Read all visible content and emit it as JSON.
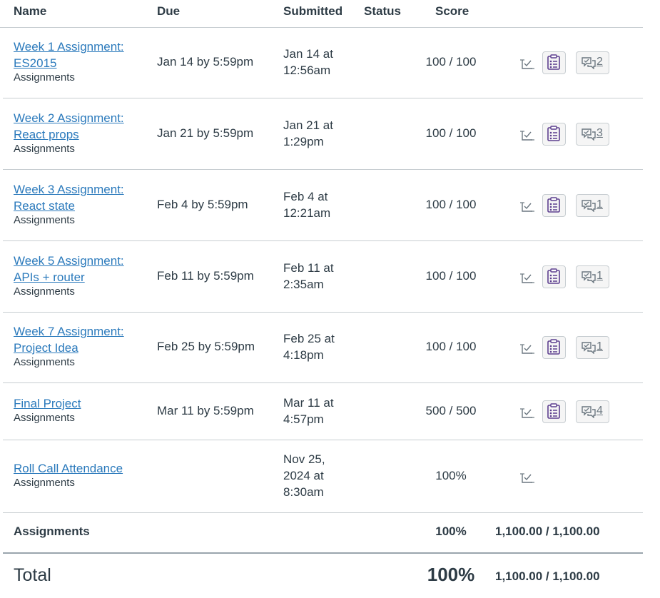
{
  "columns": {
    "name": "Name",
    "due": "Due",
    "submitted": "Submitted",
    "status": "Status",
    "score": "Score"
  },
  "rows": [
    {
      "name": [
        "Week 1 Assignment:",
        "ES2015"
      ],
      "group": "Assignments",
      "due": "Jan 14 by 5:59pm",
      "submitted": [
        "Jan 14 at",
        "12:56am"
      ],
      "score": "100 / 100",
      "comments": "2"
    },
    {
      "name": [
        "Week 2 Assignment:",
        "React props"
      ],
      "group": "Assignments",
      "due": "Jan 21 by 5:59pm",
      "submitted": [
        "Jan 21 at",
        "1:29pm"
      ],
      "score": "100 / 100",
      "comments": "3"
    },
    {
      "name": [
        "Week 3 Assignment:",
        "React state"
      ],
      "group": "Assignments",
      "due": "Feb 4 by 5:59pm",
      "submitted": [
        "Feb 4 at",
        "12:21am"
      ],
      "score": "100 / 100",
      "comments": "1"
    },
    {
      "name": [
        "Week 5 Assignment:",
        "APIs + router"
      ],
      "group": "Assignments",
      "due": "Feb 11 by 5:59pm",
      "submitted": [
        "Feb 11 at",
        "2:35am"
      ],
      "score": "100 / 100",
      "comments": "1"
    },
    {
      "name": [
        "Week 7 Assignment:",
        "Project Idea"
      ],
      "group": "Assignments",
      "due": "Feb 25 by 5:59pm",
      "submitted": [
        "Feb 25 at",
        "4:18pm"
      ],
      "score": "100 / 100",
      "comments": "1"
    },
    {
      "name": [
        "Final Project"
      ],
      "group": "Assignments",
      "due": "Mar 11 by 5:59pm",
      "submitted": [
        "Mar 11 at",
        "4:57pm"
      ],
      "score": "500 / 500",
      "comments": "4"
    },
    {
      "name": [
        "Roll Call Attendance"
      ],
      "group": "Assignments",
      "due": "",
      "submitted": [
        "Nov 25,",
        "2024 at",
        "8:30am"
      ],
      "score": "100%",
      "comments": null
    }
  ],
  "group_summary": {
    "label": "Assignments",
    "percent": "100%",
    "points": "1,100.00 / 1,100.00"
  },
  "total": {
    "label": "Total",
    "percent": "100%",
    "points": "1,100.00 / 1,100.00"
  },
  "colors": {
    "link": "#2b7abc",
    "text": "#2d3b45",
    "rubric_icon": "#5d3f8f",
    "border": "#c7cdd1"
  },
  "icons": {
    "whatif": "what-if-score-icon",
    "rubric": "rubric-icon",
    "comments": "comments-icon"
  }
}
